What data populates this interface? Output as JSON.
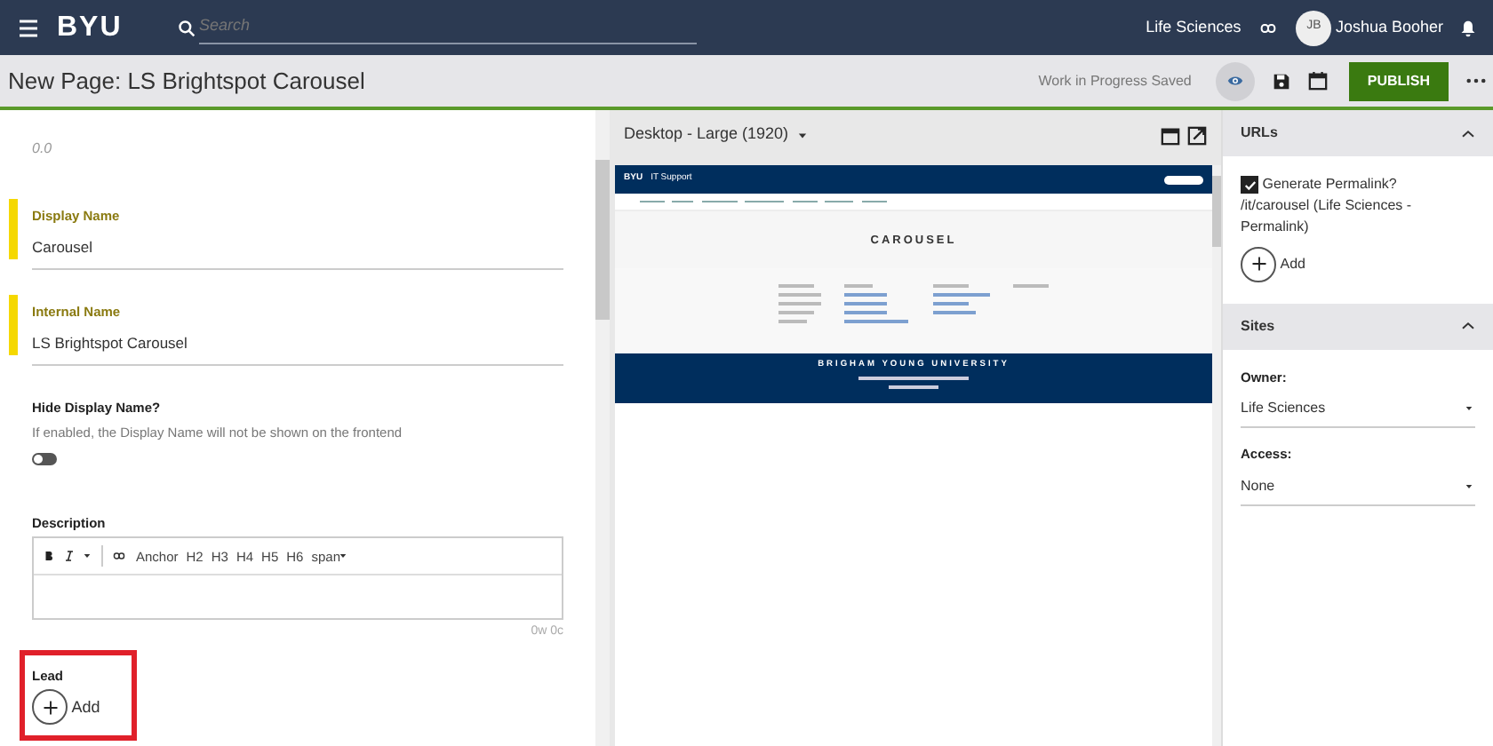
{
  "header": {
    "logo": "BYU",
    "search_placeholder": "Search",
    "site": "Life Sciences",
    "user_initials": "JB",
    "user_name": "Joshua Booher"
  },
  "toolbar": {
    "title": "New Page: LS Brightspot Carousel",
    "status": "Work in Progress Saved",
    "preview_selected": true,
    "publish": "PUBLISH"
  },
  "form": {
    "score": "0.0",
    "fields": [
      {
        "kind": "text",
        "label": "Display Name",
        "value": "Carousel",
        "required": true
      },
      {
        "kind": "text",
        "label": "Internal Name",
        "value": "LS Brightspot Carousel",
        "required": true
      },
      {
        "kind": "toggle",
        "label": "Hide Display Name?",
        "hint": "If enabled, the Display Name will not be shown on the frontend",
        "on": false
      },
      {
        "kind": "richtext",
        "label": "Description",
        "tools": [
          "Anchor",
          "H2",
          "H3",
          "H4",
          "H5",
          "H6",
          "span"
        ],
        "counter": "0w 0c"
      },
      {
        "kind": "add",
        "label": "Lead",
        "add": "Add",
        "highlighted": true
      }
    ]
  },
  "preview": {
    "device": "Desktop - Large (1920)",
    "logo": "BYU",
    "site_title": "IT Support",
    "heading": "CAROUSEL",
    "footer_title": "BRIGHAM YOUNG UNIVERSITY"
  },
  "urls": {
    "title": "URLs",
    "expanded": true,
    "checked": true,
    "checkbox_label": "Generate Permalink?",
    "path": "/it/carousel (Life Sciences - Permalink)",
    "add": "Add"
  },
  "sites": {
    "title": "Sites",
    "expanded": true,
    "selects": [
      {
        "label": "Owner:",
        "value": "Life Sciences"
      },
      {
        "label": "Access:",
        "value": "None"
      }
    ]
  }
}
